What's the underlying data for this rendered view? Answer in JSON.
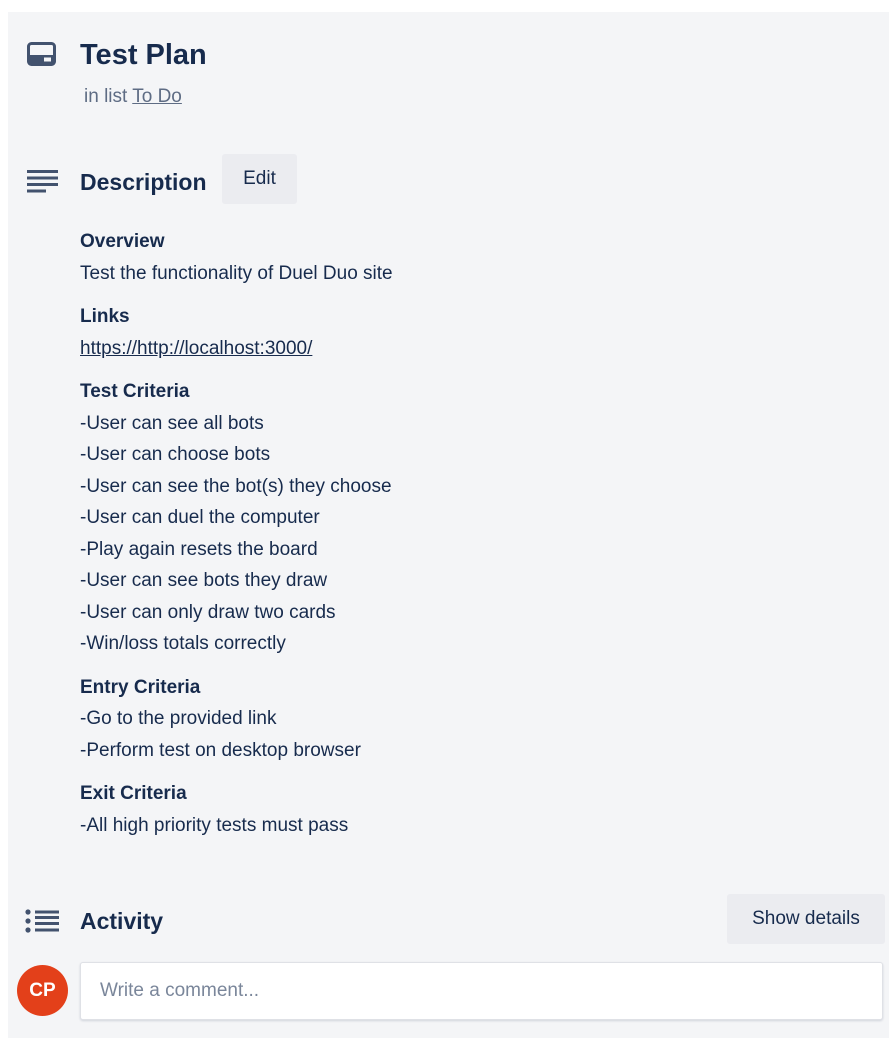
{
  "card": {
    "title": "Test Plan",
    "in_list_prefix": "in list",
    "list_name": "To Do"
  },
  "description": {
    "title": "Description",
    "edit_label": "Edit",
    "groups": [
      {
        "heading": "Overview",
        "lines": [
          "Test the functionality of Duel Duo site"
        ]
      },
      {
        "heading": "Links",
        "link": "https://http://localhost:3000/"
      },
      {
        "heading": "Test Criteria",
        "lines": [
          "-User can see all bots",
          "-User can choose bots",
          "-User can see the bot(s) they choose",
          "-User can duel the computer",
          "-Play again resets the board",
          "-User can see bots they draw",
          "-User can only draw two cards",
          "-Win/loss totals correctly"
        ]
      },
      {
        "heading": "Entry Criteria",
        "lines": [
          "-Go to the provided link",
          "-Perform test on desktop browser"
        ]
      },
      {
        "heading": "Exit Criteria",
        "lines": [
          "-All high priority tests must pass"
        ]
      }
    ]
  },
  "activity": {
    "title": "Activity",
    "show_details_label": "Show details",
    "avatar_initials": "CP",
    "comment_placeholder": "Write a comment..."
  },
  "colors": {
    "panel_bg": "#f4f5f7",
    "text": "#172b4d",
    "muted": "#5e6c84",
    "button_bg": "#ebecf0",
    "avatar_bg": "#e3401a"
  },
  "icons": [
    "card-icon",
    "description-icon",
    "activity-icon"
  ]
}
